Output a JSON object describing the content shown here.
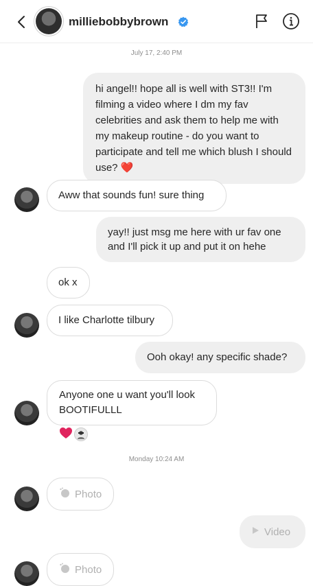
{
  "header": {
    "username": "milliebobbybrown",
    "verified": true,
    "icons": [
      "back-arrow-icon",
      "flag-icon",
      "info-icon"
    ]
  },
  "timestamps": {
    "first": "July 17, 2:40 PM",
    "second": "Monday 10:24 AM"
  },
  "messages": [
    {
      "from": "me",
      "text": "hi angel!! hope all is well with ST3!! I'm filming a video where I dm my fav celebrities and ask them to help me with my makeup routine - do you want to participate and tell me which blush I should use? ❤️"
    },
    {
      "from": "them",
      "text": "Aww that sounds fun! sure thing"
    },
    {
      "from": "me",
      "text": "yay!! just msg me here with ur fav one and I'll pick it up and put it on hehe"
    },
    {
      "from": "them",
      "text": "ok x"
    },
    {
      "from": "them",
      "text": "I like Charlotte tilbury"
    },
    {
      "from": "me",
      "text": "Ooh okay! any specific shade?"
    },
    {
      "from": "them",
      "text": "Anyone one u want you'll look BOOTIFULLL"
    },
    {
      "from": "them",
      "media_label": "Photo"
    },
    {
      "from": "me",
      "media_label": "Video"
    },
    {
      "from": "them",
      "media_label": "Photo"
    }
  ],
  "reactions": [
    "heart-icon",
    "user-avatar"
  ],
  "colors": {
    "verified": "#3897f0",
    "heart": "#e0245e",
    "incoming_border": "#dbdbdb",
    "outgoing_bg": "#efefef"
  }
}
